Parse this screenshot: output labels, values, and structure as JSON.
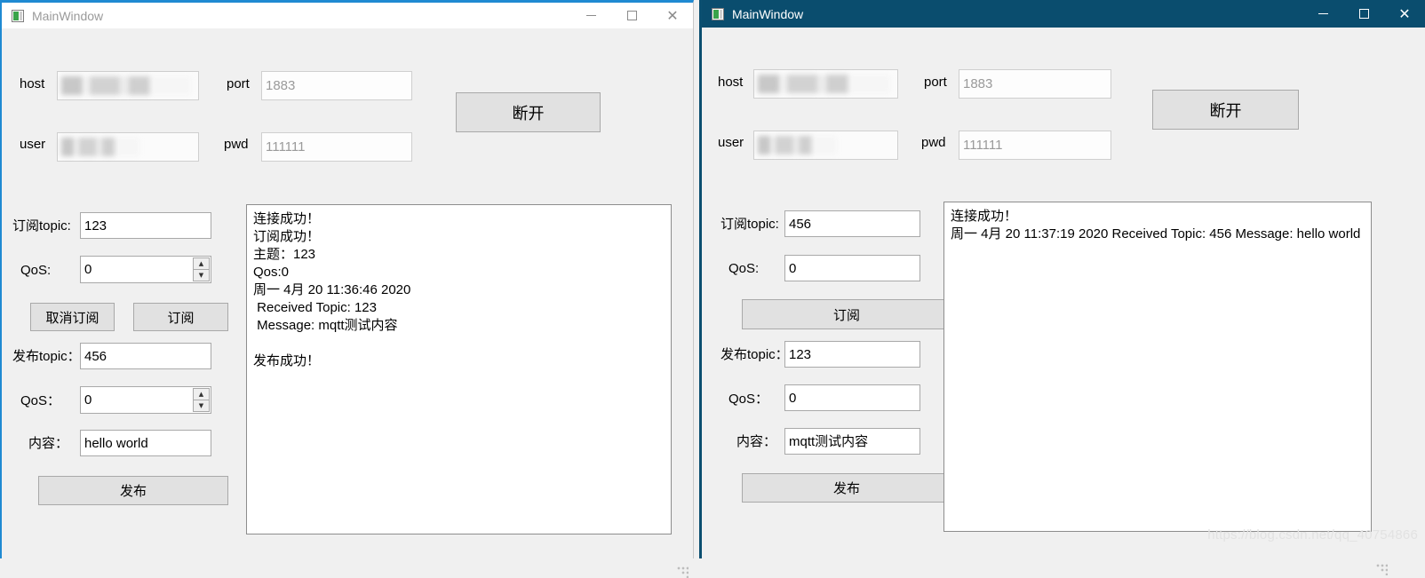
{
  "watermark": "https://blog.csdn.net/qq_40754866",
  "window_controls": {
    "minimize": "─",
    "maximize": "☐",
    "close": "×"
  },
  "left_window": {
    "title": "MainWindow",
    "icon": "app-window-icon",
    "state": "inactive",
    "accent_color": "#1f8ad2",
    "titlebar_bg": "#ffffff",
    "connection": {
      "host_label": "host",
      "host_value": "",
      "host_redacted": true,
      "port_label": "port",
      "port_value": "1883",
      "user_label": "user",
      "user_value": "",
      "user_redacted": true,
      "pwd_label": "pwd",
      "pwd_value": "111111",
      "disconnect_button": "断开"
    },
    "subscribe": {
      "topic_label": "订阅topic:",
      "topic_value": "123",
      "qos_label": "QoS:",
      "qos_value": "0",
      "unsubscribe_button": "取消订阅",
      "subscribe_button": "订阅"
    },
    "publish": {
      "topic_label": "发布topic：",
      "topic_value": "456",
      "qos_label": "QoS：",
      "qos_value": "0",
      "content_label": "内容：",
      "content_value": "hello world",
      "publish_button": "发布"
    },
    "log": "连接成功！\n订阅成功！\n主题：123\nQos:0\n周一 4月 20 11:36:46 2020\n Received Topic: 123\n Message: mqtt测试内容\n\n发布成功！"
  },
  "right_window": {
    "title": "MainWindow",
    "icon": "app-window-icon",
    "state": "active",
    "accent_color": "#0a4d6e",
    "titlebar_bg": "#0a4d6e",
    "connection": {
      "host_label": "host",
      "host_value": "",
      "host_redacted": true,
      "port_label": "port",
      "port_value": "1883",
      "user_label": "user",
      "user_value": "",
      "user_redacted": true,
      "pwd_label": "pwd",
      "pwd_value": "111111",
      "disconnect_button": "断开"
    },
    "subscribe": {
      "topic_label": "订阅topic:",
      "topic_value": "456",
      "qos_label": "QoS:",
      "qos_value": "0",
      "subscribe_button": "订阅"
    },
    "publish": {
      "topic_label": "发布topic：",
      "topic_value": "123",
      "qos_label": "QoS：",
      "qos_value": "0",
      "content_label": "内容：",
      "content_value": "mqtt测试内容",
      "publish_button": "发布"
    },
    "log": "连接成功！\n周一 4月 20 11:37:19 2020 Received Topic: 456 Message: hello world"
  }
}
